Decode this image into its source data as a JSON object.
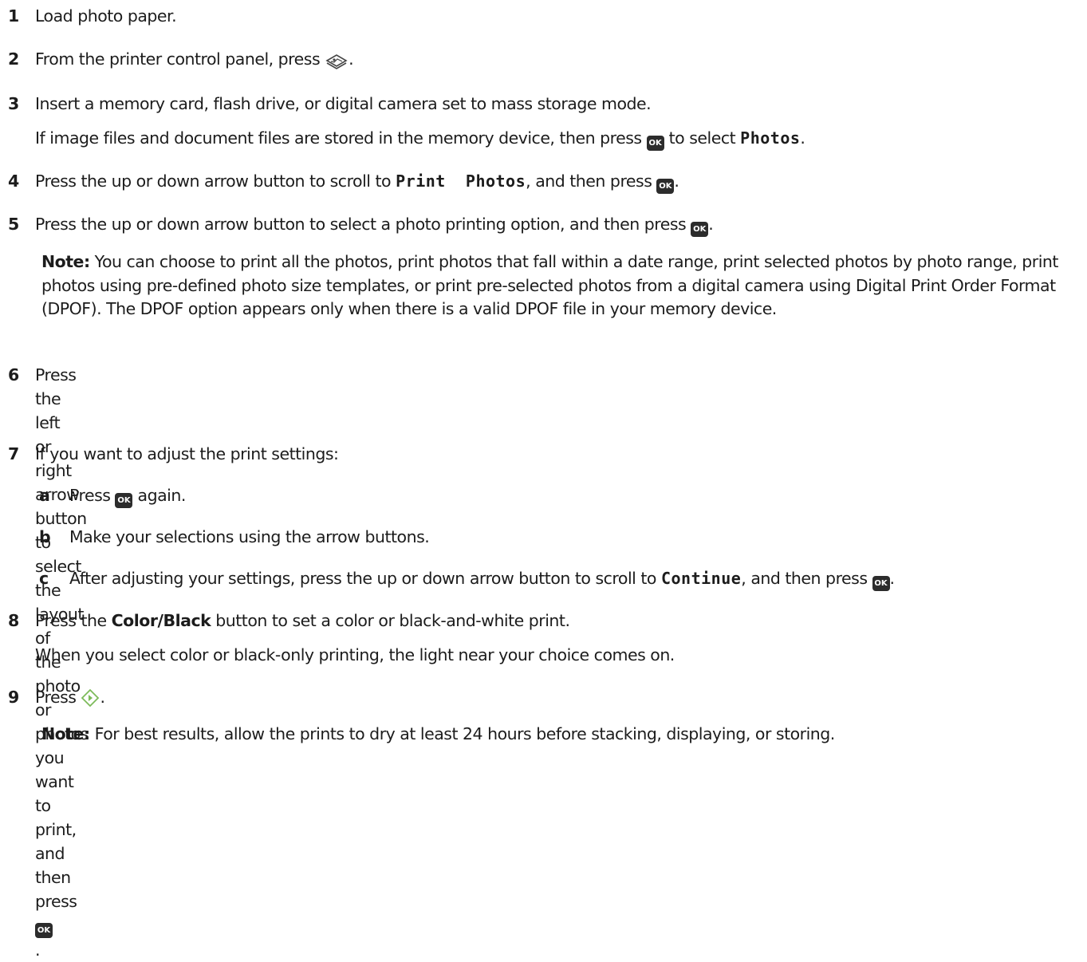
{
  "ok_label": "OK",
  "steps": {
    "s1": {
      "num": "1",
      "text": "Load photo paper."
    },
    "s2": {
      "num": "2",
      "text": "From the printer control panel, press ",
      "after": "."
    },
    "s3": {
      "num": "3",
      "text": "Insert a memory card, flash drive, or digital camera set to mass storage mode.",
      "sub_before": "If image files and document files are stored in the memory device, then press ",
      "sub_mid": " to select ",
      "sub_code": "Photos",
      "sub_after": "."
    },
    "s4": {
      "num": "4",
      "before": "Press the up or down arrow button to scroll to ",
      "code": "Print  Photos",
      "mid": ", and then press ",
      "after": "."
    },
    "s5": {
      "num": "5",
      "before": "Press the up or down arrow button to select a photo printing option, and then press ",
      "after": ".",
      "note_label": "Note:",
      "note_text": " You can choose to print all the photos, print photos that fall within a date range, print selected photos by photo range, print photos using pre-defined photo size templates, or print pre-selected photos from a digital camera using Digital Print Order Format (DPOF). The DPOF option appears only when there is a valid DPOF file in your memory device."
    },
    "s6": {
      "num": "6",
      "before": "Press the left or right arrow button to select the layout of the photo or photos you want to print, and then press ",
      "after": "."
    },
    "s7": {
      "num": "7",
      "text": "If you want to adjust the print settings:",
      "a_letter": "a",
      "a_before": "Press ",
      "a_after": " again.",
      "b_letter": "b",
      "b_text": "Make your selections using the arrow buttons.",
      "c_letter": "c",
      "c_before": "After adjusting your settings, press the up or down arrow button to scroll to ",
      "c_code": "Continue",
      "c_mid": ", and then press ",
      "c_after": "."
    },
    "s8": {
      "num": "8",
      "before": "Press the ",
      "bold": "Color/Black",
      "after": " button to set a color or black-and-white print.",
      "sub": "When you select color or black-only printing, the light near your choice comes on."
    },
    "s9": {
      "num": "9",
      "before": "Press ",
      "after": ".",
      "note_label": "Note:",
      "note_text": " For best results, allow the prints to dry at least 24 hours before stacking, displaying, or storing."
    }
  }
}
